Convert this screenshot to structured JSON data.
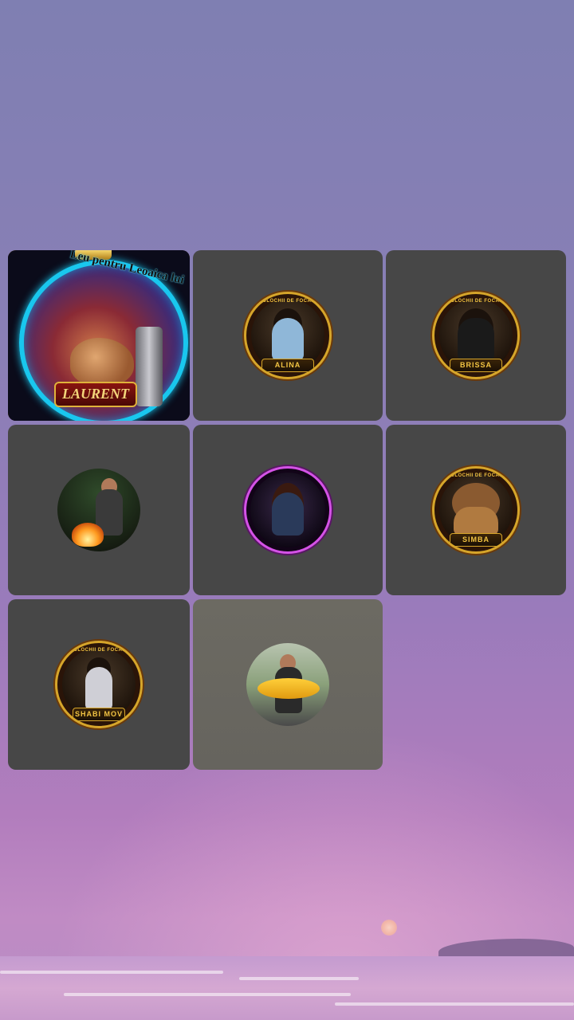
{
  "background": {
    "sky_colors": [
      "#7f7fb2",
      "#b27dbd",
      "#c08bc4"
    ]
  },
  "tiles": [
    {
      "id": "tile-1",
      "style": "feature",
      "arc_text": "Leu pentru Leoaica lui",
      "name": "LAURENT"
    },
    {
      "id": "tile-2",
      "style": "gold-badge",
      "arc_text": "VOLOCHII DE FOCANI",
      "name": "ALINA"
    },
    {
      "id": "tile-3",
      "style": "gold-badge",
      "arc_text": "VOLOCHII DE FOCANI",
      "name": "BRISSA"
    },
    {
      "id": "tile-4",
      "style": "photo-campfire"
    },
    {
      "id": "tile-5",
      "style": "pink-badge"
    },
    {
      "id": "tile-6",
      "style": "gold-badge",
      "arc_text": "VOLOCHII DE FOCANI",
      "name": "SIMBA"
    },
    {
      "id": "tile-7",
      "style": "gold-badge",
      "arc_text": "VOLOCHII DE FOCANI",
      "name": "SHABI MOV"
    },
    {
      "id": "tile-8",
      "style": "photo-fish"
    }
  ],
  "colors": {
    "tile_bg": "#474747",
    "badge_gold": "#d6a52a",
    "badge_pink": "#d452e6",
    "feature_ring": "#19c7ee"
  }
}
